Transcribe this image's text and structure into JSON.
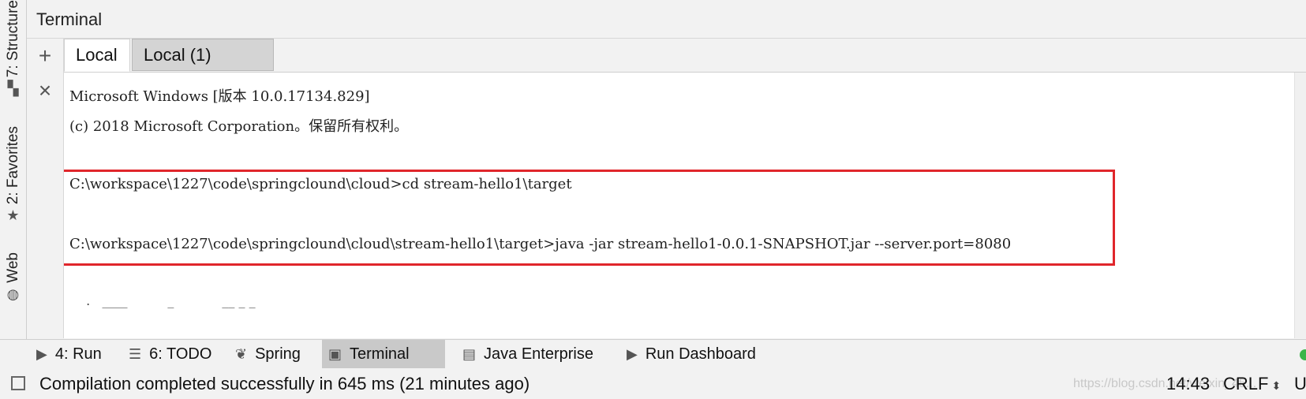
{
  "left_strip": {
    "structure_label": "7: Structure",
    "favorites_label": "2: Favorites",
    "web_label": "Web"
  },
  "tool_window": {
    "title": "Terminal",
    "add_button": "+",
    "close_button": "×"
  },
  "tabs": [
    "Local",
    "Local (1)"
  ],
  "terminal": {
    "lines": [
      "Microsoft Windows [版本 10.0.17134.829]",
      "(c) 2018 Microsoft Corporation。保留所有权利。",
      "C:\\workspace\\1227\\code\\springclound\\cloud>cd stream-hello1\\target",
      "C:\\workspace\\1227\\code\\springclound\\cloud\\stream-hello1\\target>java -jar stream-hello1-0.0.1-SNAPSHOT.jar --server.port=8080"
    ],
    "banner_fragment": "  .   ____          _            __ _ _",
    "highlight_color": "#e0262b"
  },
  "bottom_tabs": [
    {
      "label": "4: Run",
      "icon": "play-icon"
    },
    {
      "label": "6: TODO",
      "icon": "list-icon"
    },
    {
      "label": "Spring",
      "icon": "spring-leaf-icon"
    },
    {
      "label": "Terminal",
      "icon": "terminal-icon"
    },
    {
      "label": "Java Enterprise",
      "icon": "ee-icon"
    },
    {
      "label": "Run Dashboard",
      "icon": "play-icon"
    }
  ],
  "status_bar": {
    "message": "Compilation completed successfully in 645 ms (21 minutes ago)",
    "watermark": "https://blog.csdn.net/weixin_45...",
    "time": "14:43",
    "line_ending": "CRLF",
    "encoding": "U"
  },
  "colors": {
    "accent_active_tab": "#c9c9c9",
    "highlight": "#e0262b",
    "status_ok": "#3cb54a"
  }
}
